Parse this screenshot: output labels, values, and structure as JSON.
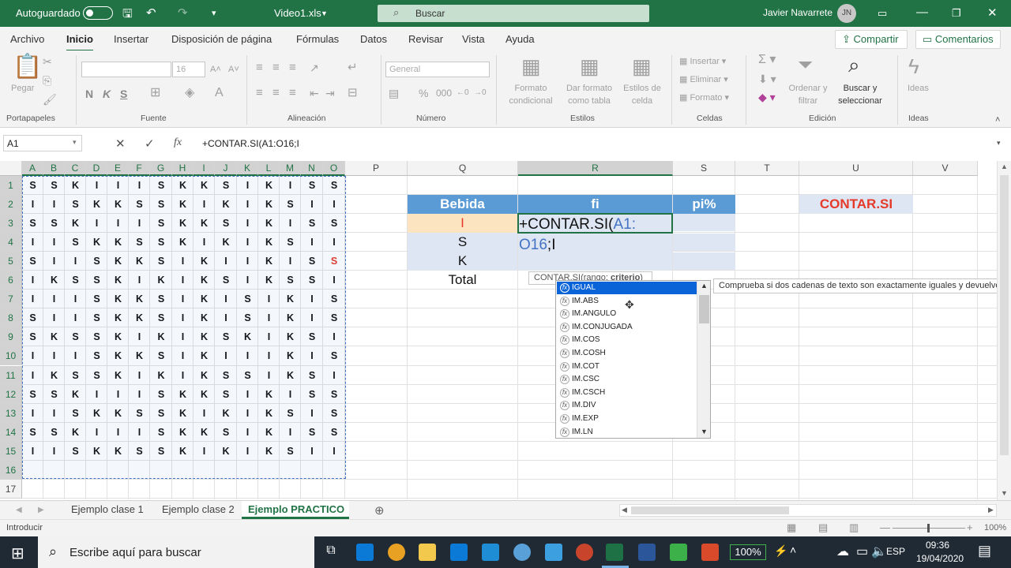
{
  "titlebar": {
    "autosave": "Autoguardado",
    "filename": "Video1.xls",
    "search_placeholder": "Buscar",
    "user": "Javier Navarrete",
    "user_initials": "JN"
  },
  "menu": {
    "items": [
      "Archivo",
      "Inicio",
      "Insertar",
      "Disposición de página",
      "Fórmulas",
      "Datos",
      "Revisar",
      "Vista",
      "Ayuda"
    ],
    "share": "Compartir",
    "comments": "Comentarios"
  },
  "ribbon": {
    "paste": "Pegar",
    "font_size": "16",
    "number_format": "General",
    "bold": "N",
    "italic": "K",
    "underline": "S",
    "cond_format": [
      "Formato",
      "condicional"
    ],
    "table_format": [
      "Dar formato",
      "como tabla"
    ],
    "cell_styles": [
      "Estilos de",
      "celda"
    ],
    "insert": "Insertar",
    "delete": "Eliminar",
    "format": "Formato",
    "sort": [
      "Ordenar y",
      "filtrar"
    ],
    "find": [
      "Buscar y",
      "seleccionar"
    ],
    "ideas": "Ideas",
    "groups": [
      "Portapapeles",
      "Fuente",
      "Alineación",
      "Número",
      "Estilos",
      "Celdas",
      "Edición",
      "Ideas"
    ]
  },
  "formula_bar": {
    "name_box": "A1",
    "formula": "+CONTAR.SI(A1:O16;I"
  },
  "columns": [
    "A",
    "B",
    "C",
    "D",
    "E",
    "F",
    "G",
    "H",
    "I",
    "J",
    "K",
    "L",
    "M",
    "N",
    "O",
    "P",
    "Q",
    "R",
    "S",
    "T",
    "U",
    "V"
  ],
  "rows": [
    "1",
    "2",
    "3",
    "4",
    "5",
    "6",
    "7",
    "8",
    "9",
    "10",
    "11",
    "12",
    "13",
    "14",
    "15",
    "16",
    "17"
  ],
  "data_rows": [
    [
      "S",
      "S",
      "K",
      "I",
      "I",
      "I",
      "S",
      "K",
      "K",
      "S",
      "I",
      "K",
      "I",
      "S",
      "S"
    ],
    [
      "I",
      "I",
      "S",
      "K",
      "K",
      "S",
      "S",
      "K",
      "I",
      "K",
      "I",
      "K",
      "S",
      "I",
      "I"
    ],
    [
      "S",
      "S",
      "K",
      "I",
      "I",
      "I",
      "S",
      "K",
      "K",
      "S",
      "I",
      "K",
      "I",
      "S",
      "S"
    ],
    [
      "I",
      "I",
      "S",
      "K",
      "K",
      "S",
      "S",
      "K",
      "I",
      "K",
      "I",
      "K",
      "S",
      "I",
      "I"
    ],
    [
      "S",
      "I",
      "I",
      "S",
      "K",
      "K",
      "S",
      "I",
      "K",
      "I",
      "I",
      "K",
      "I",
      "S",
      "S"
    ],
    [
      "I",
      "K",
      "S",
      "S",
      "K",
      "I",
      "K",
      "I",
      "K",
      "S",
      "I",
      "K",
      "S",
      "S",
      "I"
    ],
    [
      "I",
      "I",
      "I",
      "S",
      "K",
      "K",
      "S",
      "I",
      "K",
      "I",
      "S",
      "I",
      "K",
      "I",
      "S"
    ],
    [
      "S",
      "I",
      "I",
      "S",
      "K",
      "K",
      "S",
      "I",
      "K",
      "I",
      "S",
      "I",
      "K",
      "I",
      "S"
    ],
    [
      "S",
      "K",
      "S",
      "S",
      "K",
      "I",
      "K",
      "I",
      "K",
      "S",
      "K",
      "I",
      "K",
      "S",
      "I"
    ],
    [
      "I",
      "I",
      "I",
      "S",
      "K",
      "K",
      "S",
      "I",
      "K",
      "I",
      "I",
      "I",
      "K",
      "I",
      "S"
    ],
    [
      "I",
      "K",
      "S",
      "S",
      "K",
      "I",
      "K",
      "I",
      "K",
      "S",
      "S",
      "I",
      "K",
      "S",
      "I"
    ],
    [
      "S",
      "S",
      "K",
      "I",
      "I",
      "I",
      "S",
      "K",
      "K",
      "S",
      "I",
      "K",
      "I",
      "S",
      "S"
    ],
    [
      "I",
      "I",
      "S",
      "K",
      "K",
      "S",
      "S",
      "K",
      "I",
      "K",
      "I",
      "K",
      "S",
      "I",
      "S"
    ],
    [
      "S",
      "S",
      "K",
      "I",
      "I",
      "I",
      "S",
      "K",
      "K",
      "S",
      "I",
      "K",
      "I",
      "S",
      "S"
    ],
    [
      "I",
      "I",
      "S",
      "K",
      "K",
      "S",
      "S",
      "K",
      "I",
      "K",
      "I",
      "K",
      "S",
      "I",
      "I"
    ]
  ],
  "table": {
    "headers": [
      "Bebida",
      "fi",
      "pi%"
    ],
    "labels": [
      "I",
      "S",
      "K",
      "Total"
    ],
    "title": "CONTAR.SI",
    "editing_line1": "+CONTAR.SI(",
    "editing_ref1": "A1:",
    "editing_ref2": "O16",
    "editing_tail": ";I"
  },
  "tooltip": {
    "prefix": "CONTAR.SI(rango; ",
    "arg": "criterio",
    "suffix": ")"
  },
  "autocomplete": [
    "IGUAL",
    "IM.ABS",
    "IM.ANGULO",
    "IM.CONJUGADA",
    "IM.COS",
    "IM.COSH",
    "IM.COT",
    "IM.CSC",
    "IM.CSCH",
    "IM.DIV",
    "IM.EXP",
    "IM.LN"
  ],
  "description": "Comprueba si dos cadenas de texto son exactamente iguales y devuelve",
  "sheets": [
    "Ejemplo clase 1",
    "Ejemplo clase 2",
    "Ejemplo PRACTICO"
  ],
  "status": {
    "mode": "Introducir",
    "zoom": "100%"
  },
  "taskbar": {
    "search_placeholder": "Escribe aquí para buscar",
    "battery": "100%",
    "lang": "ESP",
    "time": "09:36",
    "date": "19/04/2020"
  }
}
